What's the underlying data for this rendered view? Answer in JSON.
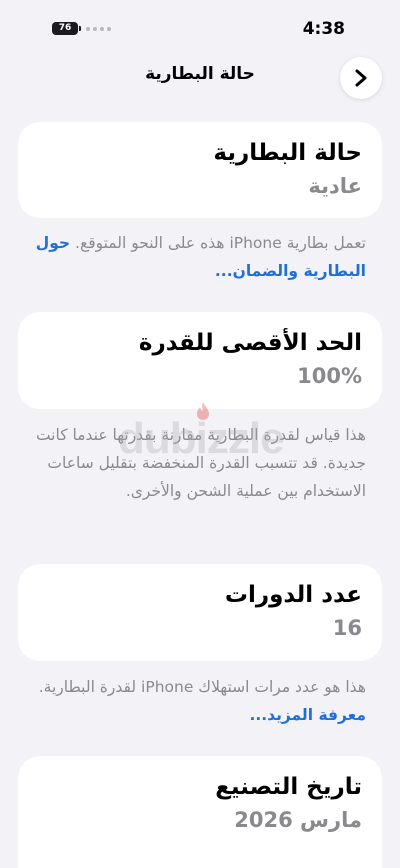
{
  "status_bar": {
    "battery_level": "76",
    "time": "4:38"
  },
  "nav": {
    "title": "حالة البطارية",
    "back_icon": "chevron-right-icon"
  },
  "cards": [
    {
      "title": "حالة البطارية",
      "value": "عادية",
      "description": "تعمل بطارية iPhone هذه على النحو المتوقع.",
      "link": "حول البطارية والضمان..."
    },
    {
      "title": "الحد الأقصى للقدرة",
      "value": "100%",
      "description": "هذا قياس لقدرة البطارية مقارنة بقدرتها عندما كانت جديدة. قد تتسبب القدرة المنخفضة بتقليل ساعات الاستخدام بين عملية الشحن والأخرى."
    },
    {
      "title": "عدد الدورات",
      "value": "16",
      "description": "هذا هو عدد مرات استهلاك iPhone لقدرة البطارية.",
      "link": "معرفة المزيد..."
    },
    {
      "title": "تاريخ التصنيع",
      "value": "مارس 2026"
    }
  ],
  "watermark": {
    "text": "dubizzle"
  },
  "colors": {
    "background": "#f2f2f7",
    "card": "#ffffff",
    "secondary_text": "#8a8a8e",
    "link": "#1f6fd6"
  }
}
